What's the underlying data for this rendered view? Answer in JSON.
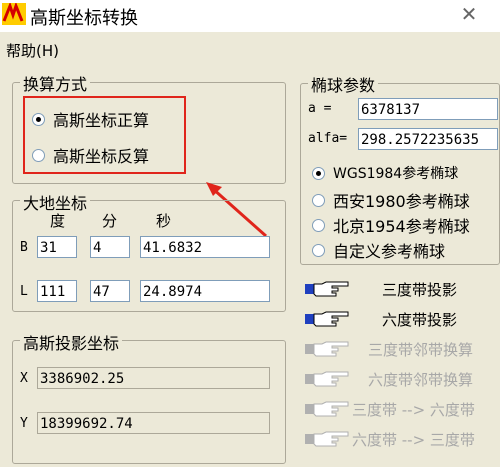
{
  "window": {
    "title": "高斯坐标转换",
    "close_glyph": "✕"
  },
  "menu": {
    "help": "帮助(H)"
  },
  "calc_mode": {
    "legend": "换算方式",
    "options": [
      {
        "label": "高斯坐标正算",
        "selected": true
      },
      {
        "label": "高斯坐标反算",
        "selected": false
      }
    ]
  },
  "geodetic": {
    "legend": "大地坐标",
    "col_deg": "度",
    "col_min": "分",
    "col_sec": "秒",
    "b": {
      "label": "B",
      "deg": "31",
      "min": "4",
      "sec": "41.6832"
    },
    "l": {
      "label": "L",
      "deg": "111",
      "min": "47",
      "sec": "24.8974"
    }
  },
  "projection": {
    "legend": "高斯投影坐标",
    "x": {
      "label": "X",
      "value": "3386902.25"
    },
    "y": {
      "label": "Y",
      "value": "18399692.74"
    }
  },
  "ellipsoid": {
    "legend": "椭球参数",
    "a": {
      "label": "a   =",
      "value": "6378137"
    },
    "alfa": {
      "label": "alfa=",
      "value": "298.2572235635"
    },
    "options": [
      {
        "label": "WGS1984参考椭球",
        "selected": true
      },
      {
        "label": "西安1980参考椭球",
        "selected": false
      },
      {
        "label": "北京1954参考椭球",
        "selected": false
      },
      {
        "label": "自定义参考椭球",
        "selected": false
      }
    ]
  },
  "actions": [
    {
      "label": "三度带投影",
      "enabled": true,
      "icon": "pointing-hand-icon"
    },
    {
      "label": "六度带投影",
      "enabled": true,
      "icon": "pointing-hand-icon"
    },
    {
      "label": "三度带邻带换算",
      "enabled": false,
      "icon": "pointing-hand-icon"
    },
    {
      "label": "六度带邻带换算",
      "enabled": false,
      "icon": "pointing-hand-icon"
    },
    {
      "label": "三度带 --> 六度带",
      "enabled": false,
      "icon": "pointing-hand-icon"
    },
    {
      "label": "六度带 --> 三度带",
      "enabled": false,
      "icon": "pointing-hand-icon"
    }
  ],
  "colors": {
    "annotation": "#e0251b",
    "enabled_cuff": "#1f3fbf",
    "disabled_cuff": "#b0b0b0"
  }
}
